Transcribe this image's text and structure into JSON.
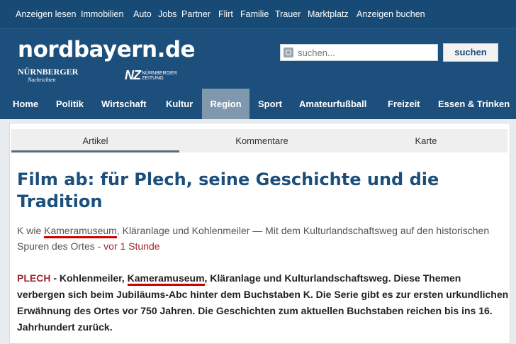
{
  "top_nav": [
    "Anzeigen lesen",
    "Immobilien",
    "Auto",
    "Jobs",
    "Partner",
    "Flirt",
    "Familie",
    "Trauer",
    "Marktplatz",
    "Anzeigen buchen"
  ],
  "logo": "nordbayern.de",
  "partner_nn": {
    "line1": "NÜRNBERGER",
    "line2": "Nachrichten"
  },
  "partner_nz": {
    "big": "NZ",
    "line1": "NÜRNBERGER",
    "line2": "ZEITUNG"
  },
  "search": {
    "placeholder": "suchen...",
    "button": "suchen"
  },
  "main_nav": [
    "Home",
    "Politik",
    "Wirtschaft",
    "Kultur",
    "Region",
    "Sport",
    "Amateurfußball",
    "Freizeit",
    "Essen & Trinken"
  ],
  "main_nav_active": "Region",
  "tabs": [
    "Artikel",
    "Kommentare",
    "Karte"
  ],
  "article": {
    "title": "Film ab: für Plech, seine Geschichte und die Tradition",
    "teaser_prefix": "K wie ",
    "teaser_highlight": "Kameramuseum",
    "teaser_rest": ", Kläranlage und Kohlenmeiler — Mit dem Kulturlandschaftsweg auf den historischen Spuren des Ortes - ",
    "time": "vor 1 Stunde",
    "location": "PLECH",
    "body_prefix": " - Kohlenmeiler, ",
    "body_highlight": "Kameramuseum",
    "body_rest": ", Kläranlage und Kulturlandschaftsweg. Diese Themen verbergen sich beim Jubiläums-Abc hinter dem Buchstaben K. Die Serie gibt es zur ersten urkundlichen Erwähnung des Ortes vor 750 Jahren. Die Geschichten zum aktuellen Buchstaben reichen bis ins 16. Jahrhundert zurück."
  }
}
